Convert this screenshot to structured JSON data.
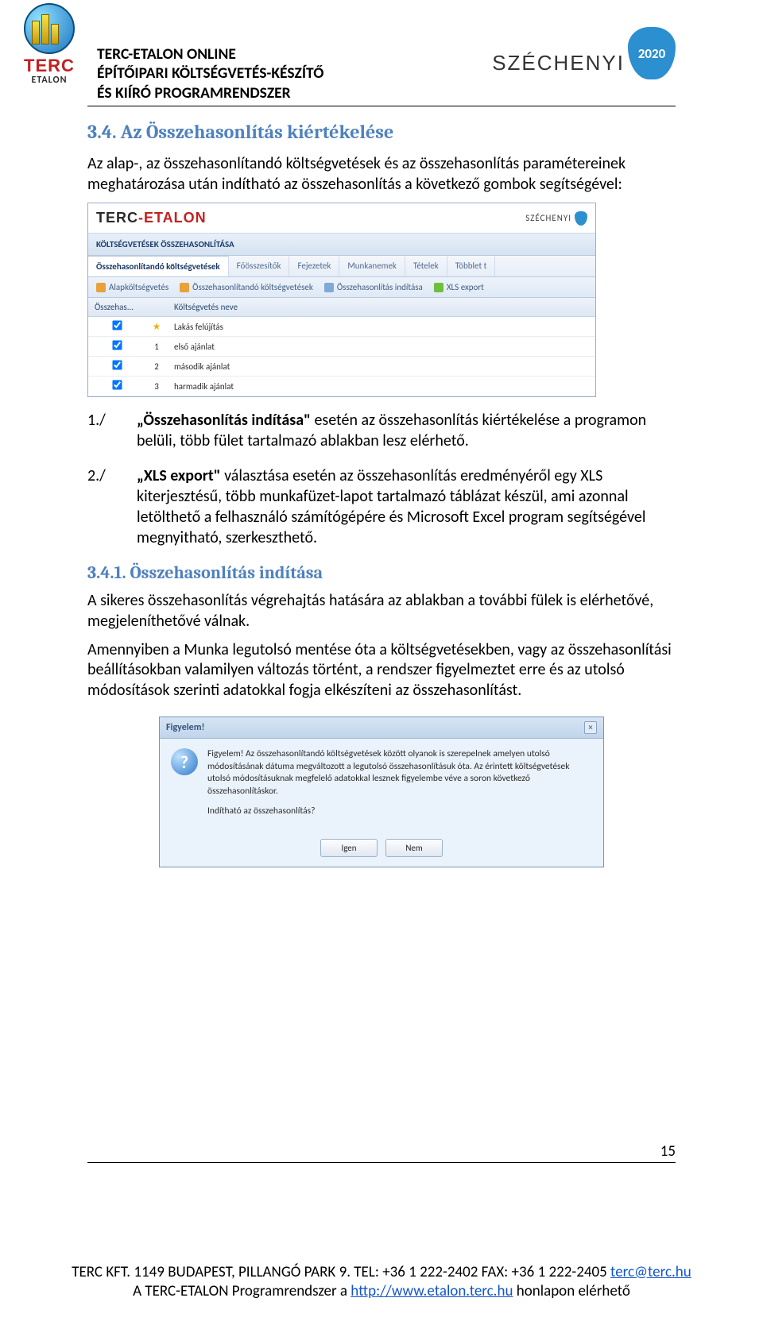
{
  "header": {
    "title_line1": "TERC-ETALON ONLINE",
    "title_line2": "ÉPÍTŐIPARI KÖLTSÉGVETÉS-KÉSZÍTŐ",
    "title_line3": "ÉS KIÍRÓ PROGRAMRENDSZER",
    "logo_brand": "TERC",
    "logo_sub": "ETALON",
    "szechenyi_label": "SZÉCHENYI",
    "szechenyi_year": "2020"
  },
  "section_34": {
    "heading": "3.4. Az Összehasonlítás kiértékelése",
    "intro": "Az alap-, az összehasonlítandó költségvetések és az összehasonlítás paramétereinek meghatározása után indítható az összehasonlítás a következő gombok segítségével:"
  },
  "shot1": {
    "brand_left": "TERC",
    "brand_right": "ETALON",
    "badge_label": "SZÉCHENYI",
    "panel_title": "KÖLTSÉGVETÉSEK ÖSSZEHASONLÍTÁSA",
    "tabs": [
      "Összehasonlítandó költségvetések",
      "Főösszesítők",
      "Fejezetek",
      "Munkanemek",
      "Tételek",
      "Többlet t"
    ],
    "toolbar": {
      "alap": "Alapköltségvetés",
      "osszehas": "Összehasonlítandó költségvetések",
      "inditas": "Összehasonlítás indítása",
      "xls": "XLS export"
    },
    "columns": [
      "Összehas...",
      "",
      "Költségvetés neve"
    ],
    "rows": [
      {
        "checked": true,
        "idx": "",
        "star": true,
        "name": "Lakás felújítás"
      },
      {
        "checked": true,
        "idx": "1",
        "star": false,
        "name": "első ajánlat"
      },
      {
        "checked": true,
        "idx": "2",
        "star": false,
        "name": "második ajánlat"
      },
      {
        "checked": true,
        "idx": "3",
        "star": false,
        "name": "harmadik ajánlat"
      }
    ]
  },
  "list": {
    "item1_num": "1./",
    "item1_text": "„Összehasonlítás indítása\" esetén az összehasonlítás kiértékelése a programon belüli, több fület tartalmazó ablakban lesz elérhető.",
    "item1_bold": "„Összehasonlítás indítása\"",
    "item1_rest": " esetén az összehasonlítás kiértékelése a programon belüli, több fület tartalmazó ablakban lesz elérhető.",
    "item2_num": "2./",
    "item2_bold": "„XLS export\"",
    "item2_rest": " választása esetén az összehasonlítás eredményéről egy XLS kiterjesztésű, több munkafüzet-lapot tartalmazó táblázat készül, ami azonnal letölthető a felhasználó számítógépére és  Microsoft Excel program segítségével megnyitható, szerkeszthető."
  },
  "section_341": {
    "heading": "3.4.1. Összehasonlítás indítása",
    "p1": "A sikeres összehasonlítás végrehajtás hatására az ablakban a további fülek is elérhetővé, megjeleníthetővé válnak.",
    "p2": "Amennyiben a Munka legutolsó mentése óta a költségvetésekben, vagy az összehasonlítási beállításokban valamilyen változás történt, a rendszer figyelmeztet erre és az utolsó módosítások szerinti adatokkal fogja elkészíteni az összehasonlítást."
  },
  "dialog": {
    "title": "Figyelem!",
    "body": "Figyelem! Az összehasonlítandó költségvetések között olyanok is szerepelnek amelyen utolsó módosításának dátuma megváltozott a legutolsó összehasonlításuk óta. Az érintett költségvetések utolsó módosításuknak megfelelő adatokkal lesznek figyelembe véve a soron következő összehasonlításkor.",
    "question": "Indítható az összehasonlítás?",
    "yes": "Igen",
    "no": "Nem"
  },
  "page_number": "15",
  "footer": {
    "line1_pre": "TERC KFT. 1149 BUDAPEST, PILLANGÓ PARK 9. TEL: +36 1 222-2402 FAX: +36 1 222-2405 ",
    "line1_link": "terc@terc.hu",
    "line2_pre": "A TERC-ETALON Programrendszer a ",
    "line2_link": "http://www.etalon.terc.hu",
    "line2_post": " honlapon elérhető"
  }
}
